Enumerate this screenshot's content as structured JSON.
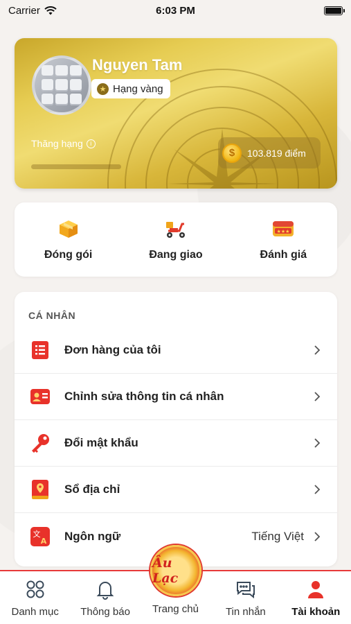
{
  "status_bar": {
    "carrier": "Carrier",
    "time": "6:03 PM"
  },
  "profile": {
    "name": "Nguyen Tam",
    "rank_label": "Hạng vàng",
    "rank_up_label": "Thăng hạng",
    "points": "103.819 điểm",
    "progress": 0.0
  },
  "quick_actions": [
    {
      "label": "Đóng gói",
      "icon": "package-icon"
    },
    {
      "label": "Đang giao",
      "icon": "delivery-scooter-icon"
    },
    {
      "label": "Đánh giá",
      "icon": "rating-stars-icon"
    }
  ],
  "personal": {
    "title": "CÁ NHÂN",
    "items": [
      {
        "label": "Đơn hàng của tôi",
        "icon": "order-list-icon",
        "value": ""
      },
      {
        "label": "Chỉnh sửa thông tin cá nhân",
        "icon": "id-card-icon",
        "value": ""
      },
      {
        "label": "Đổi mật khẩu",
        "icon": "key-icon",
        "value": ""
      },
      {
        "label": "Sổ địa chỉ",
        "icon": "address-book-icon",
        "value": ""
      },
      {
        "label": "Ngôn ngữ",
        "icon": "language-icon",
        "value": "Tiếng Việt"
      }
    ]
  },
  "tab_bar": {
    "items": [
      {
        "label": "Danh mục",
        "icon": "category-grid-icon"
      },
      {
        "label": "Thông báo",
        "icon": "bell-icon"
      },
      {
        "label": "Trang chủ",
        "icon": "home-logo-icon"
      },
      {
        "label": "Tin nhắn",
        "icon": "chat-icon"
      },
      {
        "label": "Tài khoản",
        "icon": "user-icon"
      }
    ],
    "logo_text": "Âu Lạc",
    "active_index": 4
  },
  "colors": {
    "accent": "#e73a3a",
    "gold": "#e6cc52"
  }
}
